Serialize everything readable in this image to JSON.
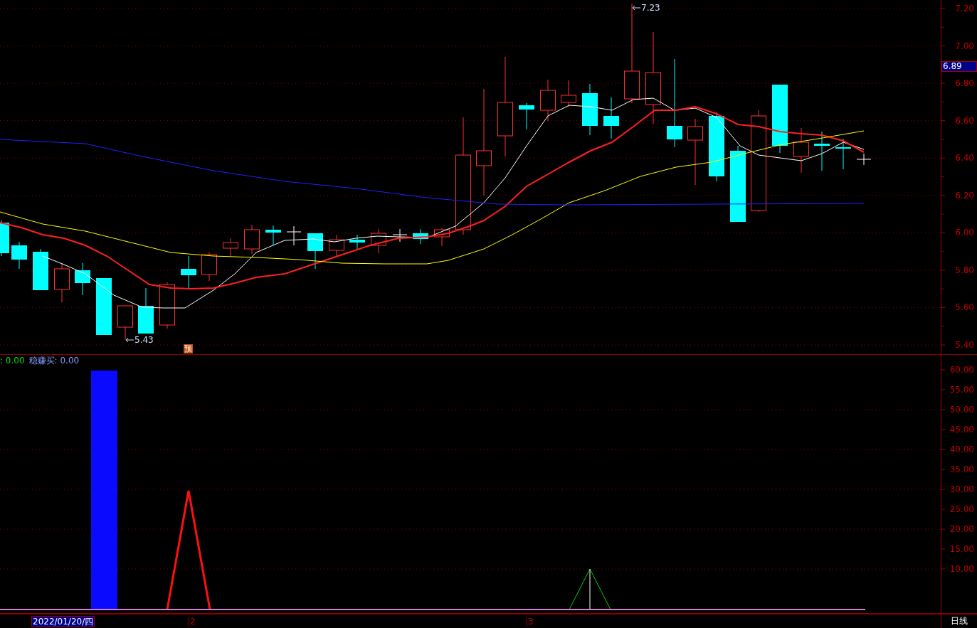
{
  "price_axis": {
    "labels": [
      "7.20",
      "7.00",
      "6.80",
      "6.60",
      "6.40",
      "6.20",
      "6.00",
      "5.80",
      "5.60",
      "5.40"
    ],
    "current_price": "6.89"
  },
  "price_markers": [
    {
      "kind": "high",
      "value": "7.23"
    },
    {
      "kind": "low",
      "value": "5.43"
    }
  ],
  "forecast_badge": "预",
  "indicator_legend": [
    {
      "text": ": 0.00",
      "color": "#00e000"
    },
    {
      "text": "稳赚买: 0.00",
      "color": "#8a9cff"
    }
  ],
  "indicator_axis": {
    "labels": [
      "60.00",
      "55.00",
      "50.00",
      "45.00",
      "40.00",
      "35.00",
      "30.00",
      "25.00",
      "20.00",
      "15.00",
      "10.00"
    ]
  },
  "time_axis": {
    "cursor_date": "2022/01/20/四",
    "months": [
      "2",
      "3"
    ],
    "period": "日线"
  }
}
